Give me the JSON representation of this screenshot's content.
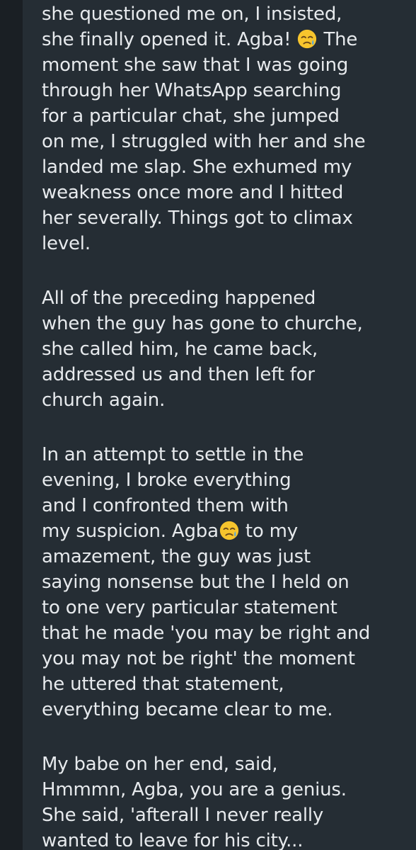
{
  "post": {
    "paragraphs": [
      {
        "lines": [
          "she questioned me on, I insisted,",
          "she finally opened it. Agba! {emoji} The",
          "moment she saw that I was going",
          "through her WhatsApp searching",
          "for a particular chat, she jumped",
          "on me, I struggled with her and she",
          "landed me slap. She exhumed my",
          "weakness once more and I hitted",
          "her severally. Things got to climax",
          "level."
        ]
      },
      {
        "lines": [
          "All of the preceding happened",
          "when the guy has gone to churche,",
          "she called him, he came back,",
          "addressed us and then left for",
          "church again."
        ]
      },
      {
        "lines": [
          "In an attempt to settle in the",
          "evening, I broke everything",
          "and I confronted them with",
          "my suspicion. Agba{emoji} to my",
          "amazement, the guy was just",
          "saying nonsense but the I held on",
          "to one very particular statement",
          "that he made 'you may be right and",
          "you may not be right' the moment",
          "he uttered that statement,",
          "everything became clear to me."
        ]
      },
      {
        "lines": [
          "My babe on her end, said,",
          "Hmmmn, Agba, you are a genius.",
          "She said, 'afterall I never really",
          "wanted to leave for his city..."
        ]
      }
    ],
    "emoji_icon": "sad-but-relieved-face-icon"
  },
  "colors": {
    "background": "#1c2126",
    "card": "#252d34",
    "text": "#e7eaed"
  }
}
